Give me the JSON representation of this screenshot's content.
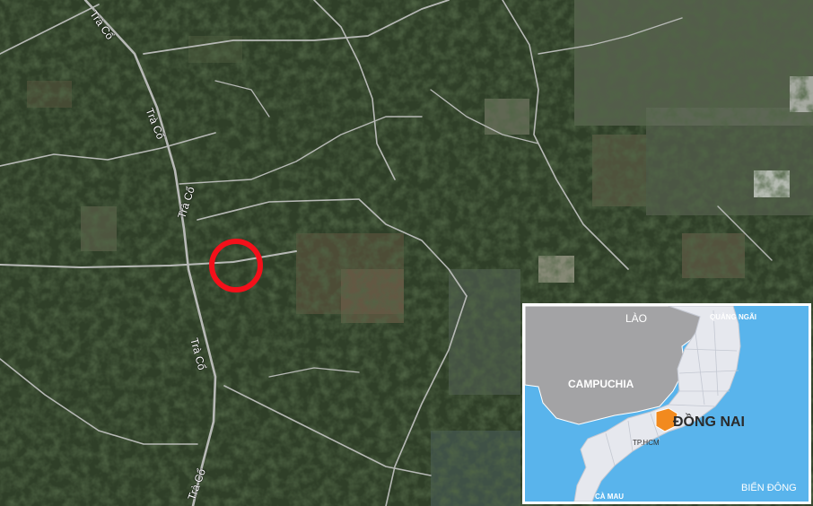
{
  "map": {
    "type": "satellite",
    "road_labels": [
      {
        "text": "Trà Cổ"
      },
      {
        "text": "Trà Cổ"
      },
      {
        "text": "Trà Cổ"
      },
      {
        "text": "Trà Cổ"
      },
      {
        "text": "Trà Cổ"
      }
    ],
    "marker": {
      "name": "location-marker",
      "color": "#f4101a"
    }
  },
  "inset": {
    "labels": {
      "laos": "LÀO",
      "quang_ngai": "QUẢNG NGÃI",
      "cambodia": "CAMPUCHIA",
      "dong_nai": "ĐỒNG NAI",
      "hcmc": "TP.HCM",
      "ca_mau": "CÀ MAU",
      "east_sea": "BIỂN ĐÔNG"
    },
    "colors": {
      "sea": "#59b4ec",
      "neighbor_land": "#a3a3a5",
      "vietnam_land": "#e6e8ee",
      "highlight": "#f28a1e"
    }
  }
}
